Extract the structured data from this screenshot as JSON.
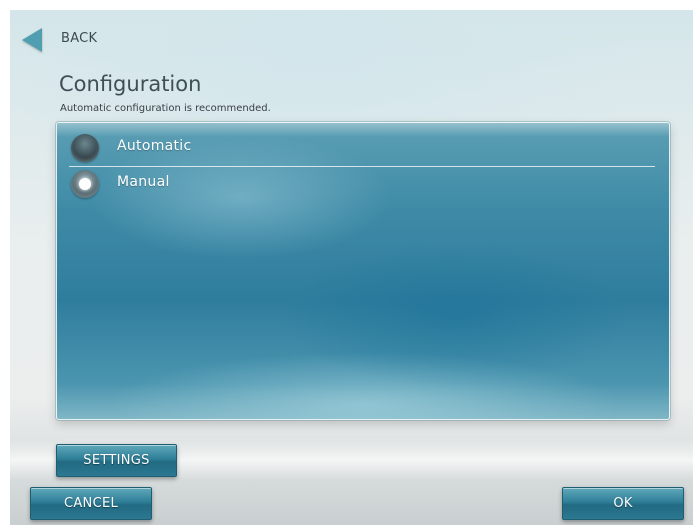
{
  "header": {
    "back_label": "BACK"
  },
  "page": {
    "title": "Configuration",
    "subtitle": "Automatic configuration is recommended."
  },
  "options": [
    {
      "label": "Automatic",
      "selected": false
    },
    {
      "label": "Manual",
      "selected": true
    }
  ],
  "buttons": {
    "settings": "SETTINGS",
    "cancel": "CANCEL",
    "ok": "OK"
  },
  "colors": {
    "accent": "#2f7f98",
    "back_arrow": "#4f9fb0"
  }
}
